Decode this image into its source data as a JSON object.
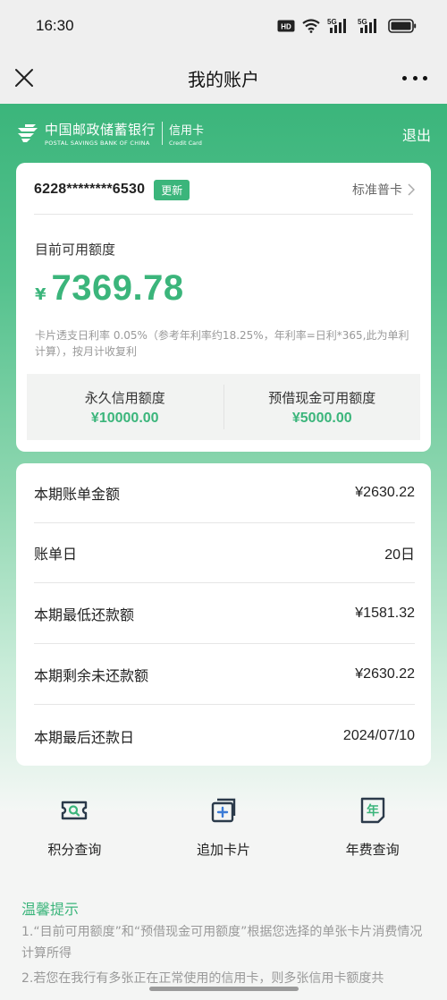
{
  "status_bar": {
    "time": "16:30",
    "icons": [
      "hd-icon",
      "wifi-icon",
      "signal-5g-icon",
      "signal-5g-icon",
      "battery-icon"
    ],
    "net1": "5G",
    "net2": "5G"
  },
  "nav": {
    "title": "我的账户",
    "close_icon": "close-icon",
    "more_icon": "more-icon"
  },
  "brand": {
    "name_cn": "中国邮政储蓄银行",
    "name_en": "POSTAL SAVINGS BANK OF CHINA",
    "product_cn": "信用卡",
    "product_en": "Credit Card",
    "logout_label": "退出"
  },
  "card": {
    "number": "6228********6530",
    "update_label": "更新",
    "level_label": "标准普卡",
    "available_label": "目前可用额度",
    "currency": "¥",
    "available_amount": "7369.78",
    "rate_note": "卡片透支日利率 0.05%（参考年利率约18.25%，年利率=日利*365,此为单利计算），按月计收复利",
    "permanent_label": "永久信用额度",
    "permanent_value": "¥10000.00",
    "cash_label": "预借现金可用额度",
    "cash_value": "¥5000.00"
  },
  "bill": {
    "rows": [
      {
        "label": "本期账单金额",
        "value": "¥2630.22"
      },
      {
        "label": "账单日",
        "value": "20日"
      },
      {
        "label": "本期最低还款额",
        "value": "¥1581.32"
      },
      {
        "label": "本期剩余未还款额",
        "value": "¥2630.22"
      },
      {
        "label": "本期最后还款日",
        "value": "2024/07/10"
      }
    ]
  },
  "actions": [
    {
      "label": "积分查询",
      "icon": "points-search-icon"
    },
    {
      "label": "追加卡片",
      "icon": "add-card-icon"
    },
    {
      "label": "年费查询",
      "icon": "annual-fee-icon",
      "glyph": "年"
    }
  ],
  "tips": {
    "title": "温馨提示",
    "line1": "1.“目前可用额度”和“预借现金可用额度”根据您选择的单张卡片消费情况计算所得",
    "line2": "2.若您在我行有多张正在正常使用的信用卡，则多张信用卡额度共"
  },
  "colors": {
    "accent": "#3bb57b",
    "muted_text": "#999999"
  }
}
